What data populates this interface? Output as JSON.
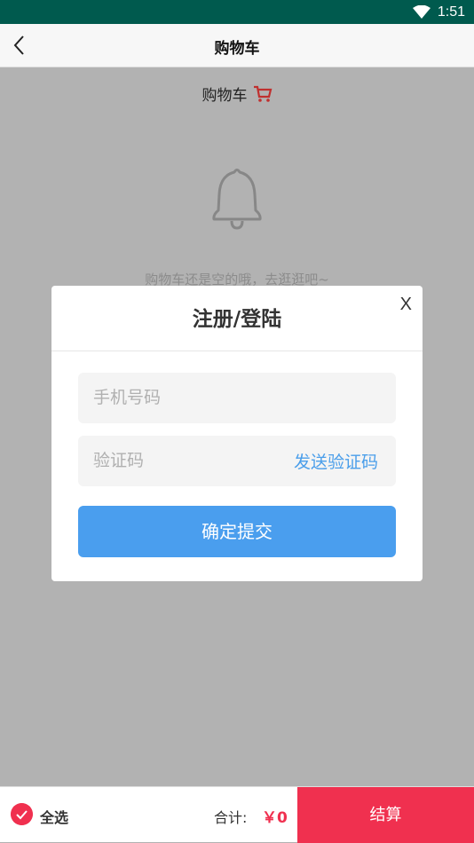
{
  "status_bar": {
    "time": "1:51",
    "icons": [
      "wifi-icon"
    ]
  },
  "nav": {
    "title": "购物车",
    "back_icon": "chevron-left-icon"
  },
  "content": {
    "cart_heading": "购物车",
    "cart_icon": "shopping-cart-icon",
    "empty_icon": "bell-icon",
    "empty_text": "购物车还是空的哦，去逛逛吧~"
  },
  "modal": {
    "title": "注册/登陆",
    "close_label": "X",
    "phone_placeholder": "手机号码",
    "code_placeholder": "验证码",
    "send_code_label": "发送验证码",
    "submit_label": "确定提交"
  },
  "bottom": {
    "select_all_label": "全选",
    "total_label": "合计:",
    "total_amount": "￥0",
    "checkout_label": "结算"
  },
  "colors": {
    "status_bar": "#005a4e",
    "accent_red": "#f0304f",
    "primary_blue": "#4a9eee"
  }
}
